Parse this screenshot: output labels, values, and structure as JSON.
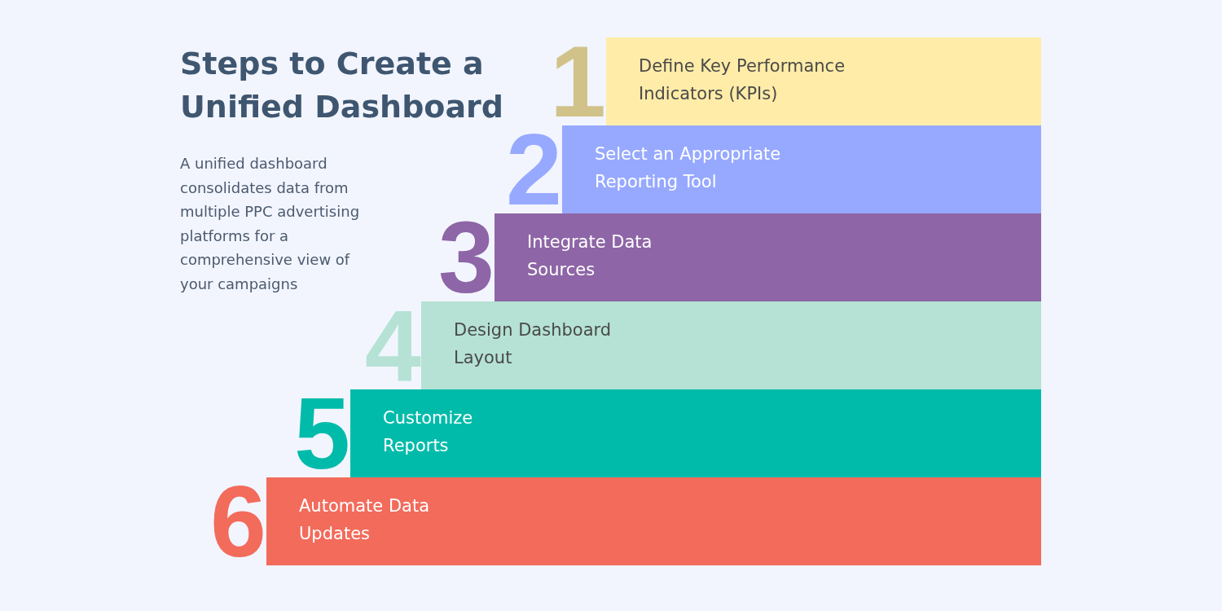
{
  "title": "Steps to Create a Unified Dashboard",
  "description": "A unified dashboard consolidates data from multiple PPC advertising platforms for a comprehensive view of your campaigns",
  "steps": [
    {
      "number": "1",
      "label": "Define Key Performance\nIndicators (KPIs)",
      "color": "#ffeca8"
    },
    {
      "number": "2",
      "label": "Select an Appropriate\nReporting Tool",
      "color": "#97a9ff"
    },
    {
      "number": "3",
      "label": "Integrate Data\nSources",
      "color": "#8e65a6"
    },
    {
      "number": "4",
      "label": "Design Dashboard\nLayout",
      "color": "#b5e2d4"
    },
    {
      "number": "5",
      "label": "Customize\nReports",
      "color": "#00bbaa"
    },
    {
      "number": "6",
      "label": "Automate Data\nUpdates",
      "color": "#f26b5b"
    }
  ]
}
